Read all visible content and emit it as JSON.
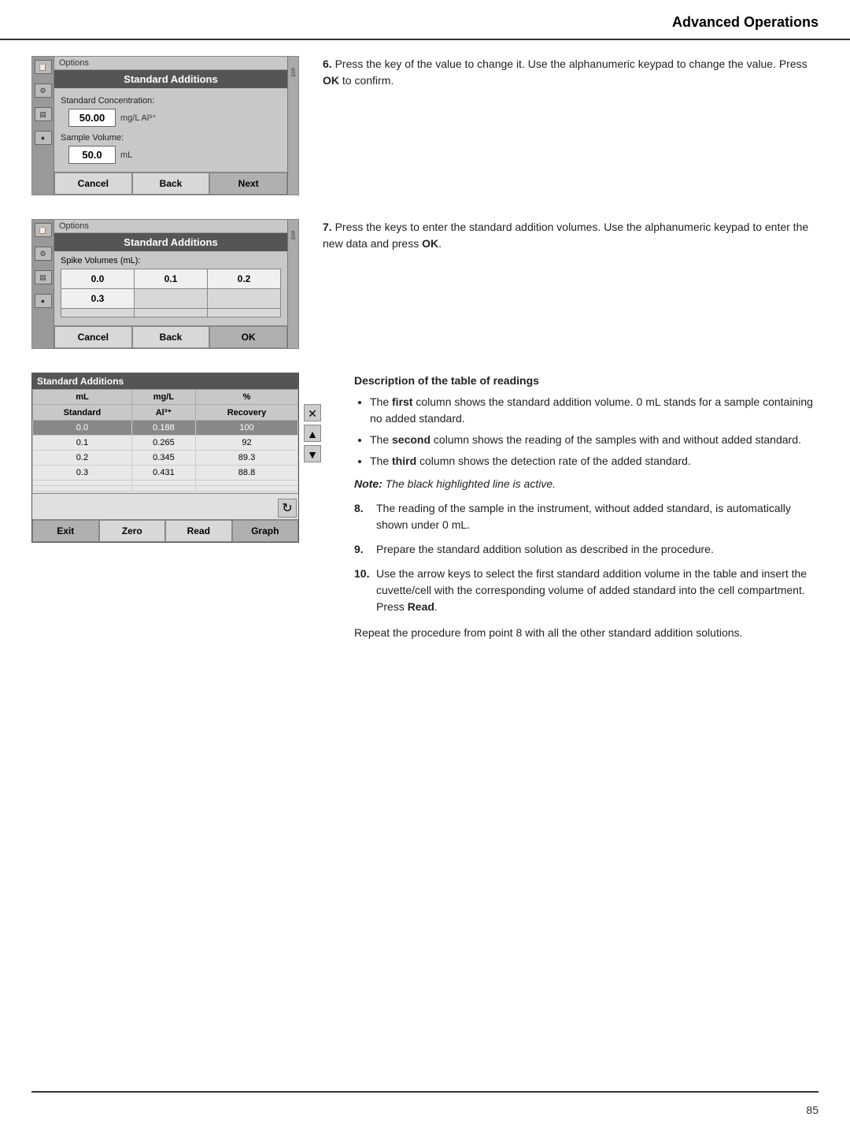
{
  "header": {
    "title": "Advanced Operations"
  },
  "footer": {
    "page_number": "85"
  },
  "section1": {
    "device": {
      "options_label": "Options",
      "title": "Standard Additions",
      "std_conc_label": "Standard Concentration:",
      "std_conc_value": "50.00",
      "std_conc_unit": "mg/L Al³⁺",
      "sample_vol_label": "Sample Volume:",
      "sample_vol_value": "50.0",
      "sample_vol_unit": "mL",
      "btn_cancel": "Cancel",
      "btn_back": "Back",
      "btn_next": "Next",
      "right_bar_label": "ent"
    },
    "step_num": "6.",
    "step_text": "Press the key of the value to change it. Use the alphanumeric keypad to change the value. Press ",
    "step_bold": "OK",
    "step_text2": " to confirm."
  },
  "section2": {
    "device": {
      "options_label": "Options",
      "title": "Standard Additions",
      "spike_label": "Spike Volumes (mL):",
      "cells": [
        "0.0",
        "0.1",
        "0.2",
        "0.3",
        "",
        "",
        "",
        "",
        ""
      ],
      "btn_cancel": "Cancel",
      "btn_back": "Back",
      "btn_ok": "OK",
      "right_bar_label": "ent"
    },
    "step_num": "7.",
    "step_text": "Press the keys to enter the standard addition volumes. Use the alphanumeric keypad to enter the new data and press ",
    "step_bold": "OK",
    "step_text2": "."
  },
  "section3": {
    "table": {
      "title": "Standard Additions",
      "col1": "mL",
      "col2": "mg/L",
      "col3": "%",
      "col1sub": "Standard",
      "col2sub": "Al³⁺",
      "col3sub": "Recovery",
      "rows": [
        {
          "c1": "0.0",
          "c2": "0.188",
          "c3": "100",
          "active": true
        },
        {
          "c1": "0.1",
          "c2": "0.265",
          "c3": "92",
          "active": false
        },
        {
          "c1": "0.2",
          "c2": "0.345",
          "c3": "89.3",
          "active": false
        },
        {
          "c1": "0.3",
          "c2": "0.431",
          "c3": "88.8",
          "active": false
        },
        {
          "c1": "",
          "c2": "",
          "c3": "",
          "active": false
        },
        {
          "c1": "",
          "c2": "",
          "c3": "",
          "active": false
        }
      ],
      "btn_exit": "Exit",
      "btn_zero": "Zero",
      "btn_read": "Read",
      "btn_graph": "Graph"
    },
    "desc_heading": "Description of the table of readings",
    "bullets": [
      {
        "text_start": "The ",
        "text_bold": "first",
        "text_end": " column shows the standard addition volume. 0 mL stands for a sample containing no added standard."
      },
      {
        "text_start": "The ",
        "text_bold": "second",
        "text_end": " column shows the reading of the samples with and without added standard."
      },
      {
        "text_start": "The ",
        "text_bold": "third",
        "text_end": " column shows the detection rate of the added standard."
      }
    ],
    "note_label": "Note:",
    "note_text": " The black highlighted line is active.",
    "step8_num": "8.",
    "step8_text": "The reading of the sample in the instrument, without added standard, is automatically shown under 0 mL.",
    "step9_num": "9.",
    "step9_text": "Prepare the standard addition solution as described in the procedure.",
    "step10_num": "10.",
    "step10_text": "Use the arrow keys to select the first standard addition volume in the table and insert the cuvette/cell with the corresponding volume of added standard into the cell compartment. Press ",
    "step10_bold": "Read",
    "step10_text2": ".",
    "repeat_text": "Repeat the procedure from point 8 with all the other standard addition solutions."
  }
}
